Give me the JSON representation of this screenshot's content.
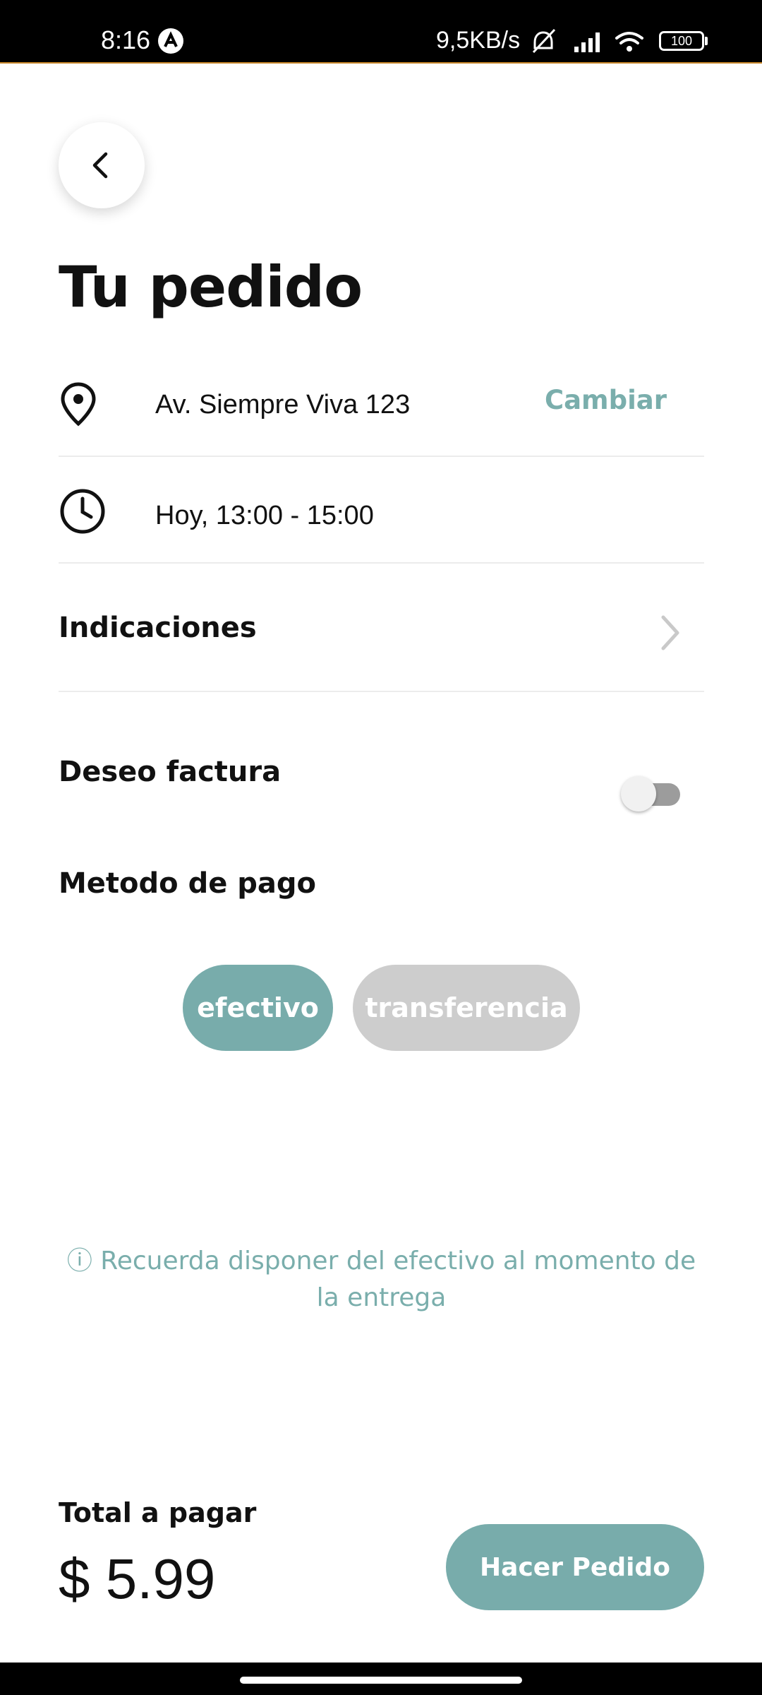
{
  "status_bar": {
    "time": "8:16",
    "net_speed": "9,5KB/s",
    "battery": "100",
    "icons": [
      "alert-icon",
      "mute-icon",
      "signal-icon",
      "wifi-icon",
      "battery-icon"
    ]
  },
  "header": {
    "back_icon": "chevron-left-icon",
    "title": "Tu pedido"
  },
  "address": {
    "icon": "location-pin-icon",
    "text": "Av. Siempre Viva 123",
    "action": "Cambiar"
  },
  "schedule": {
    "icon": "clock-icon",
    "text": "Hoy, 13:00 - 15:00"
  },
  "indications": {
    "label": "Indicaciones",
    "icon": "chevron-right-icon"
  },
  "invoice": {
    "label": "Deseo factura",
    "enabled": false
  },
  "payment": {
    "label": "Metodo de pago",
    "options": [
      {
        "label": "efectivo",
        "selected": true
      },
      {
        "label": "transferencia",
        "selected": false
      }
    ],
    "note": "ⓘ Recuerda disponer del efectivo al momento de la entrega"
  },
  "footer": {
    "total_label": "Total a pagar",
    "total_value": "$ 5.99",
    "order_button": "Hacer Pedido"
  },
  "colors": {
    "accent": "#78acab",
    "inactive": "#cdcdcd",
    "text": "#111111"
  }
}
